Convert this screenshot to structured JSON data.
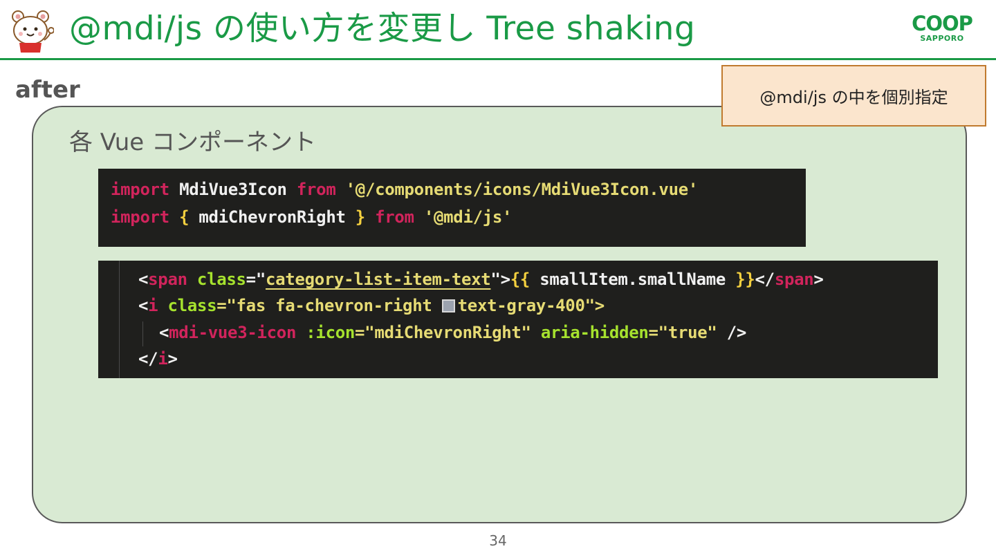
{
  "header": {
    "title": "@mdi/js の使い方を変更し Tree shaking",
    "logo_main": "COOP",
    "logo_sub": "SAPPORO",
    "accent_color": "#1a9a46"
  },
  "section": {
    "label": "after"
  },
  "callout": {
    "text": "@mdi/js の中を個別指定"
  },
  "panel": {
    "heading": "各 Vue コンポーネント"
  },
  "code_import": {
    "line1": {
      "keyword": "import",
      "name": "MdiVue3Icon",
      "from": "from",
      "path": "'@/components/icons/MdiVue3Icon.vue'"
    },
    "line2": {
      "keyword": "import",
      "open_brace": "{",
      "name": "mdiChevronRight",
      "close_brace": "}",
      "from": "from",
      "path": "'@mdi/js'"
    }
  },
  "code_template": {
    "line1": {
      "lt": "<",
      "tag": "span",
      "attr": "class",
      "eq_quote": "=\"",
      "value": "category-list-item-text",
      "close_quote": "\">",
      "mustache_open": "{{",
      "expr": " smallItem.smallName ",
      "mustache_close": "}}",
      "end_open": "</",
      "end_tag": "span",
      "end_close": ">"
    },
    "line2": {
      "lt": "<",
      "tag": "i",
      "attr": "class",
      "value": "=\"fas fa-chevron-right ",
      "value2": "text-gray-400\">"
    },
    "line3": {
      "lt": "<",
      "tag": "mdi-vue3-icon",
      "attr1": ":icon",
      "value1": "=\"mdiChevronRight\"",
      "attr2": "aria-hidden",
      "value2": "=\"true\"",
      "close": "/>"
    },
    "line4": {
      "end_open": "</",
      "tag": "i",
      "end_close": ">"
    }
  },
  "footer": {
    "page_number": "34"
  }
}
